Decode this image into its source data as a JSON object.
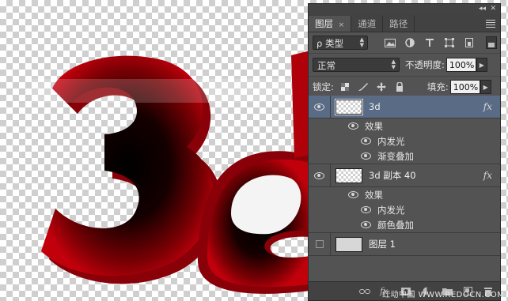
{
  "panel": {
    "topbar": {
      "collapse": "◂◂",
      "close": "✕"
    },
    "tabs": [
      {
        "label": "图层",
        "close": "×"
      },
      {
        "label": "通道"
      },
      {
        "label": "路径"
      }
    ],
    "filter": {
      "kind_label": "ρ 类型"
    },
    "blend": {
      "mode": "正常",
      "opacity_label": "不透明度:",
      "opacity_value": "100%"
    },
    "lock": {
      "label": "锁定:",
      "fill_label": "填充:",
      "fill_value": "100%"
    },
    "layers": [
      {
        "name": "3d",
        "fx": "fx",
        "effects_label": "效果",
        "effects": [
          "内发光",
          "渐变叠加"
        ]
      },
      {
        "name": "3d 副本 40",
        "fx": "fx",
        "effects_label": "效果",
        "effects": [
          "内发光",
          "颜色叠加"
        ]
      },
      {
        "name": "图层 1"
      }
    ],
    "bottom_bar": {
      "fx": "fx."
    }
  },
  "watermark": "红动中国 WWW.REDOCN.COM",
  "colors": {
    "panel_bg": "#535353",
    "selected_row": "#596b85",
    "artwork_red": "#c2000c"
  }
}
